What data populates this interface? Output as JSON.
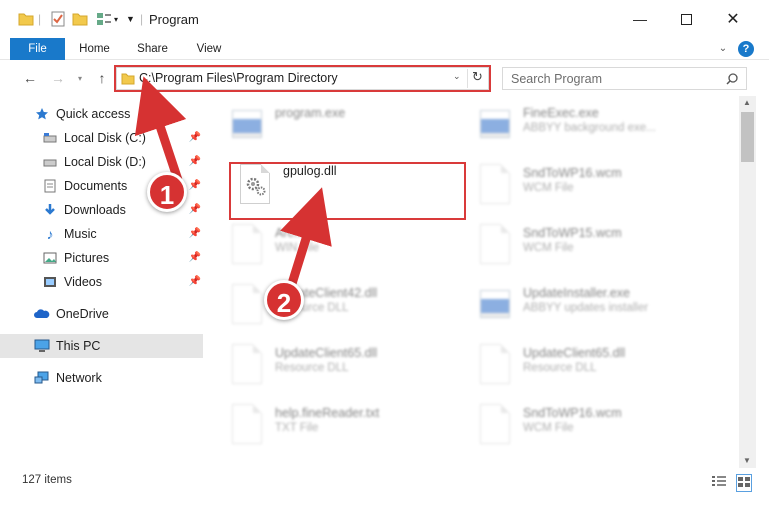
{
  "window": {
    "title": "Program"
  },
  "ribbon": {
    "tabs": [
      "File",
      "Home",
      "Share",
      "View"
    ]
  },
  "address": {
    "path": "C:\\Program Files\\Program Directory"
  },
  "search": {
    "placeholder": "Search Program"
  },
  "sidebar": {
    "items": [
      {
        "label": "Quick access",
        "icon": "star-icon"
      },
      {
        "label": "Local Disk (C:)",
        "icon": "drive-icon"
      },
      {
        "label": "Local Disk (D:)",
        "icon": "drive-icon"
      },
      {
        "label": "Documents",
        "icon": "documents-icon"
      },
      {
        "label": "Downloads",
        "icon": "downloads-icon"
      },
      {
        "label": "Music",
        "icon": "music-icon"
      },
      {
        "label": "Pictures",
        "icon": "pictures-icon"
      },
      {
        "label": "Videos",
        "icon": "videos-icon"
      },
      {
        "label": "OneDrive",
        "icon": "cloud-icon"
      },
      {
        "label": "This PC",
        "icon": "computer-icon"
      },
      {
        "label": "Network",
        "icon": "network-icon"
      }
    ]
  },
  "files": [
    {
      "name": "program.exe",
      "type": ""
    },
    {
      "name": "FineExec.exe",
      "type": "ABBYY background exe..."
    },
    {
      "name": "gpulog.dll",
      "type": ""
    },
    {
      "name": "SndToWP16.wcm",
      "type": "WCM File"
    },
    {
      "name": "Arc...d",
      "type": "WIN File"
    },
    {
      "name": "SndToWP15.wcm",
      "type": "WCM File"
    },
    {
      "name": "UpdateClient42.dll",
      "type": "Resource DLL"
    },
    {
      "name": "UpdateInstaller.exe",
      "type": "ABBYY updates installer"
    },
    {
      "name": "UpdateClient65.dll",
      "type": "Resource DLL"
    },
    {
      "name": "UpdateClient65.dll",
      "type": "Resource DLL"
    },
    {
      "name": "help.fineReader.txt",
      "type": "TXT File"
    },
    {
      "name": "SndToWP16.wcm",
      "type": "WCM File"
    }
  ],
  "status": {
    "items": "127 items"
  },
  "callouts": [
    "1",
    "2"
  ],
  "colors": {
    "accent": "#1979ca",
    "highlight": "#d93a3a"
  }
}
